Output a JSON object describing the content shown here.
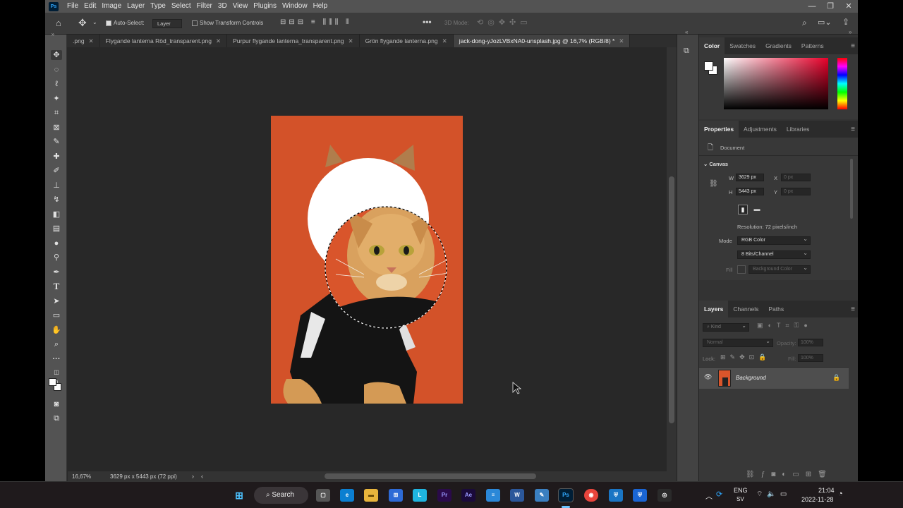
{
  "menubar": {
    "app_icon": "Ps",
    "items": [
      "File",
      "Edit",
      "Image",
      "Layer",
      "Type",
      "Select",
      "Filter",
      "3D",
      "View",
      "Plugins",
      "Window",
      "Help"
    ]
  },
  "options": {
    "auto_select_label": "Auto-Select:",
    "layer_dropdown": "Layer",
    "show_transform_label": "Show Transform Controls",
    "mode_3d_label": "3D Mode:",
    "more_label": "•••"
  },
  "tabs": [
    {
      "label": ".png"
    },
    {
      "label": "Flygande lanterna Röd_transparent.png"
    },
    {
      "label": "Purpur flygande lanterna_transparent.png"
    },
    {
      "label": "Grön flygande lanterna.png"
    },
    {
      "label": "jack-dong-yJozLVBxNA0-unsplash.jpg @ 16,7% (RGB/8) *"
    }
  ],
  "status": {
    "zoom": "16,67%",
    "dims": "3629 px x 5443 px (72 ppi)"
  },
  "color_panel": {
    "tabs": [
      "Color",
      "Swatches",
      "Gradients",
      "Patterns"
    ]
  },
  "properties": {
    "tabs": [
      "Properties",
      "Adjustments",
      "Libraries"
    ],
    "doc_label": "Document",
    "canvas_label": "Canvas",
    "w_label": "W",
    "w_value": "3629 px",
    "h_label": "H",
    "h_value": "5443 px",
    "x_label": "X",
    "x_value": "0 px",
    "y_label": "Y",
    "y_value": "0 px",
    "resolution": "Resolution: 72 pixels/inch",
    "mode_label": "Mode",
    "mode_value": "RGB Color",
    "bits_value": "8 Bits/Channel",
    "fill_label": "Fill",
    "fill_value": "Background Color"
  },
  "layers": {
    "tabs": [
      "Layers",
      "Channels",
      "Paths"
    ],
    "kind_label": "Kind",
    "blend_mode": "Normal",
    "opacity_label": "Opacity:",
    "opacity_value": "100%",
    "lock_label": "Lock:",
    "fill_label": "Fill:",
    "fill_value": "100%",
    "layer_name": "Background"
  },
  "taskbar": {
    "search_label": "Search",
    "lang": "ENG",
    "lang_sub": "SV",
    "time": "21:04",
    "date": "2022-11-28"
  },
  "colors": {
    "canvas_bg": "#d9552b",
    "accent": "#31a8ff"
  }
}
